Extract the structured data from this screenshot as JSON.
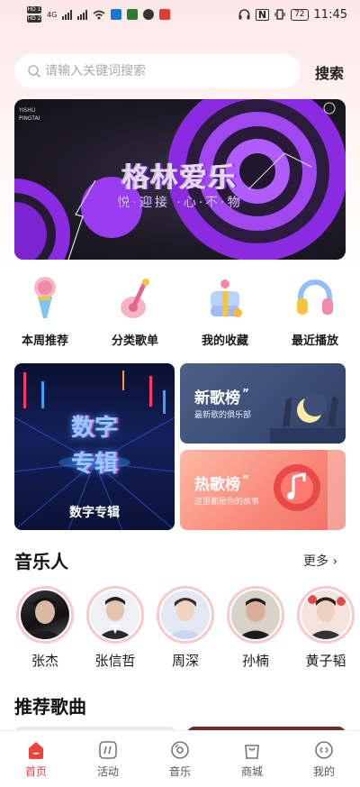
{
  "status_bar": {
    "sim1": "HD 1",
    "sim2": "HD 2",
    "network": "4G",
    "battery": "72",
    "time": "11:45"
  },
  "search": {
    "placeholder": "请输入关键词搜索",
    "button_label": "搜索"
  },
  "banner": {
    "corner_text_1": "YISHU",
    "corner_text_2": "PINGTAI",
    "title": "格林爱乐",
    "subtitle": "悦·迎接 ·心·不·物"
  },
  "quick_nav": [
    {
      "label": "本周推荐",
      "icon": "microphone-icon"
    },
    {
      "label": "分类歌单",
      "icon": "guitar-icon"
    },
    {
      "label": "我的收藏",
      "icon": "gift-box-icon"
    },
    {
      "label": "最近播放",
      "icon": "headphones-icon"
    }
  ],
  "features": {
    "album": {
      "art_line1": "数字",
      "art_line2": "专辑",
      "label": "数字专辑"
    },
    "new_chart": {
      "title": "新歌榜",
      "subtitle": "最新歌的俱乐部"
    },
    "hot_chart": {
      "title": "热歌榜",
      "subtitle": "这里都是你的故事"
    }
  },
  "musicians": {
    "title": "音乐人",
    "more": "更多",
    "artists": [
      {
        "name": "张杰"
      },
      {
        "name": "张信哲"
      },
      {
        "name": "周深"
      },
      {
        "name": "孙楠"
      },
      {
        "name": "黄子韬"
      }
    ]
  },
  "recommended": {
    "title": "推荐歌曲"
  },
  "tab_bar": {
    "tabs": [
      {
        "label": "首页",
        "icon": "home-icon",
        "active": true
      },
      {
        "label": "活动",
        "icon": "activity-icon",
        "active": false
      },
      {
        "label": "音乐",
        "icon": "disc-icon",
        "active": false
      },
      {
        "label": "商城",
        "icon": "shopping-bag-icon",
        "active": false
      },
      {
        "label": "我的",
        "icon": "profile-icon",
        "active": false
      }
    ]
  },
  "colors": {
    "accent": "#f0413e",
    "banner_purple": "#8a2be2"
  }
}
